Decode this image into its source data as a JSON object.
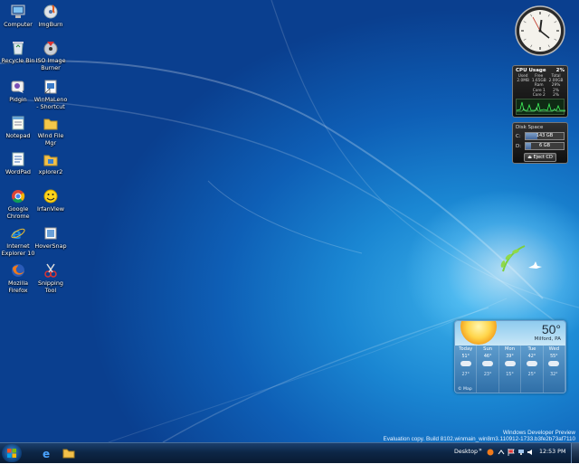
{
  "desktop_icons": [
    {
      "name": "computer-icon",
      "label": "Computer"
    },
    {
      "name": "recycle-bin-icon",
      "label": "Recycle Bin"
    },
    {
      "name": "pidgin-icon",
      "label": "Pidgin"
    },
    {
      "name": "notepad-icon",
      "label": "Notepad"
    },
    {
      "name": "wordpad-icon",
      "label": "WordPad"
    },
    {
      "name": "chrome-icon",
      "label": "Google Chrome"
    },
    {
      "name": "ie-icon",
      "label": "Internet Explorer 10"
    },
    {
      "name": "firefox-icon",
      "label": "Mozilla Firefox"
    },
    {
      "name": "imgburn-icon",
      "label": "ImgBurn"
    },
    {
      "name": "iso-burner-icon",
      "label": "ISO Image Burner"
    },
    {
      "name": "winmaclean-icon",
      "label": "WinMaLeno - Shortcut"
    },
    {
      "name": "wind-file-mgr-icon",
      "label": "Wind File Mgr"
    },
    {
      "name": "xplorer2-icon",
      "label": "xplorer2"
    },
    {
      "name": "irfanview-icon",
      "label": "IrfanView"
    },
    {
      "name": "hoversnap-icon",
      "label": "HoverSnap"
    },
    {
      "name": "snipping-tool-icon",
      "label": "Snipping Tool"
    }
  ],
  "cpu_gadget": {
    "title": "CPU Usage",
    "percent": "2%",
    "header": [
      "Used",
      "Free",
      "Total"
    ],
    "mem": [
      "2.0MB",
      "1.65GB",
      "2.00GB"
    ],
    "rows": [
      {
        "label": "Ram",
        "value": "29%"
      },
      {
        "label": "Core 1",
        "value": "2%"
      },
      {
        "label": "Core 2",
        "value": "2%"
      }
    ]
  },
  "disk_gadget": {
    "title": "Disk Space",
    "drives": [
      {
        "letter": "C:",
        "value": "143 GB",
        "fill": 0.3
      },
      {
        "letter": "D:",
        "value": "6 GB",
        "fill": 0.15
      }
    ],
    "eject_label": "Eject CD"
  },
  "weather": {
    "temp": "50°",
    "location": "Milford, PA",
    "days": [
      {
        "name": "Today",
        "hi": "51°",
        "lo": "27°"
      },
      {
        "name": "Sun",
        "hi": "46°",
        "lo": "23°"
      },
      {
        "name": "Mon",
        "hi": "39°",
        "lo": "15°"
      },
      {
        "name": "Tue",
        "hi": "42°",
        "lo": "25°"
      },
      {
        "name": "Wed",
        "hi": "55°",
        "lo": "32°"
      }
    ],
    "map_label": "© Map"
  },
  "watermark": {
    "line1": "Windows Developer Preview",
    "line2": "Evaluation copy. Build 8102.winmain_win8m3.110912-1733.b3fe2b73af7110"
  },
  "taskbar": {
    "desktop_label": "Desktop",
    "chevron": "»",
    "time": "12:53 PM"
  }
}
